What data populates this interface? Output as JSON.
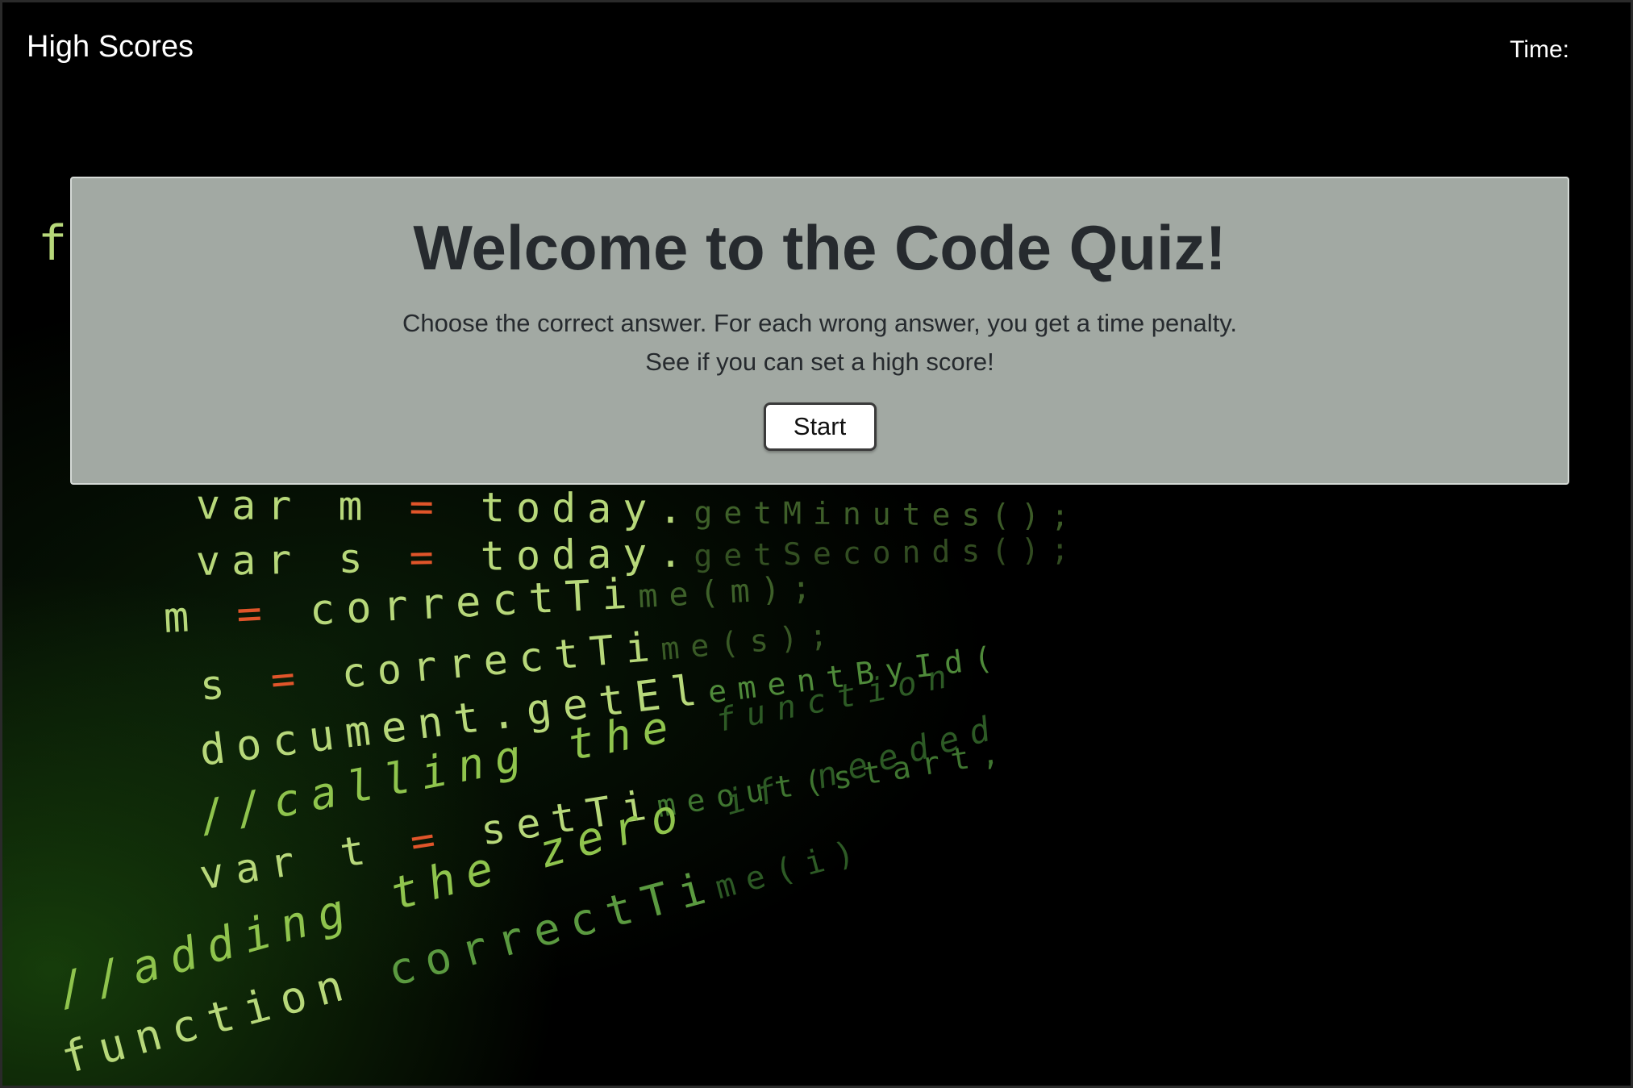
{
  "navbar": {
    "high_scores_link": "High Scores",
    "time_label": "Time:",
    "time_value": ""
  },
  "welcome": {
    "title": "Welcome to the Code Quiz!",
    "line1": "Choose the correct answer. For each wrong answer, you get a time penalty.",
    "line2": "See if you can set a high score!",
    "start_button": "Start"
  },
  "background_code": {
    "top_letter": "f",
    "lines": [
      {
        "kw": "var",
        "id": "m",
        "op": "=",
        "rest": "today.",
        "fn": "getMinutes();"
      },
      {
        "kw": "var",
        "id": "s",
        "op": "=",
        "rest": "today.",
        "fn": "getSeconds();"
      },
      {
        "kw": "m",
        "op": "=",
        "rest": "correctTi",
        "fn": "me(m);"
      },
      {
        "kw": "s",
        "op": "=",
        "rest": "correctTi",
        "fn": "me(s);"
      },
      {
        "kw": "document.",
        "rest": "getEl",
        "fn": "ementById("
      },
      {
        "comment": "//calling the",
        "fn": "function"
      },
      {
        "kw": "var",
        "id": "t",
        "op": "=",
        "rest": "setTi",
        "fn": "meout(start,"
      },
      {
        "comment": "//adding the zero",
        "fn": "if needed"
      },
      {
        "kw": "function",
        "rest": "correctTi",
        "fn": "me(i)"
      }
    ]
  },
  "colors": {
    "navbar_bg": "#000000",
    "card_bg": "#a2a9a3",
    "title_text": "#262a2e",
    "code_keyword": "#b7d87a",
    "code_operator": "#e0552a"
  }
}
